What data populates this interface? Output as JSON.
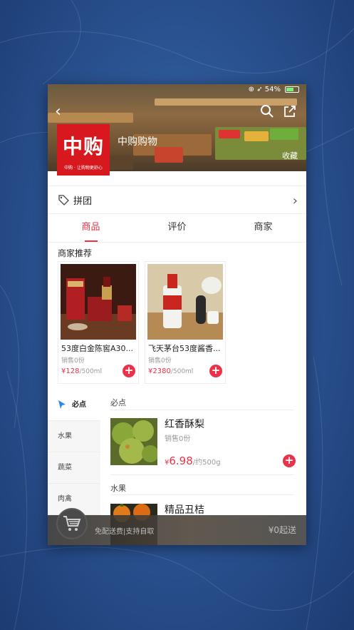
{
  "header": {
    "status_right": "⊕ ➶ 54%",
    "store_name": "中购购物",
    "favorite_label": "收藏",
    "logo_text": "中购",
    "logo_slogan": "中购 · 让购物更舒心"
  },
  "pintuan": {
    "label": "拼团"
  },
  "tabs": [
    {
      "label": "商品",
      "active": true
    },
    {
      "label": "评价",
      "active": false
    },
    {
      "label": "商家",
      "active": false
    }
  ],
  "recommend": {
    "title": "商家推荐",
    "items": [
      {
        "name": "53度白金陈窖A30...",
        "sold": "销售0份",
        "currency": "¥",
        "price": "128",
        "unit": "/500ml"
      },
      {
        "name": "飞天茅台53度酱香...",
        "sold": "销售0份",
        "currency": "¥",
        "price": "2380",
        "unit": "/500ml"
      }
    ]
  },
  "categories": [
    {
      "label": "必点",
      "active": true
    },
    {
      "label": "水果",
      "active": false
    },
    {
      "label": "蔬菜",
      "active": false
    },
    {
      "label": "肉禽",
      "active": false
    }
  ],
  "sections": [
    {
      "title": "必点",
      "product": {
        "name": "红香酥梨",
        "sold": "销售0份",
        "currency": "¥",
        "price": "6.98",
        "unit": "/约500g"
      }
    },
    {
      "title": "水果",
      "product": {
        "name": "精品丑桔"
      }
    }
  ],
  "cart": {
    "delivery_text": "免配送费|支持自取",
    "min_order_text": "¥0起送"
  },
  "colors": {
    "accent": "#e8334a",
    "logo_red": "#d7191f"
  }
}
